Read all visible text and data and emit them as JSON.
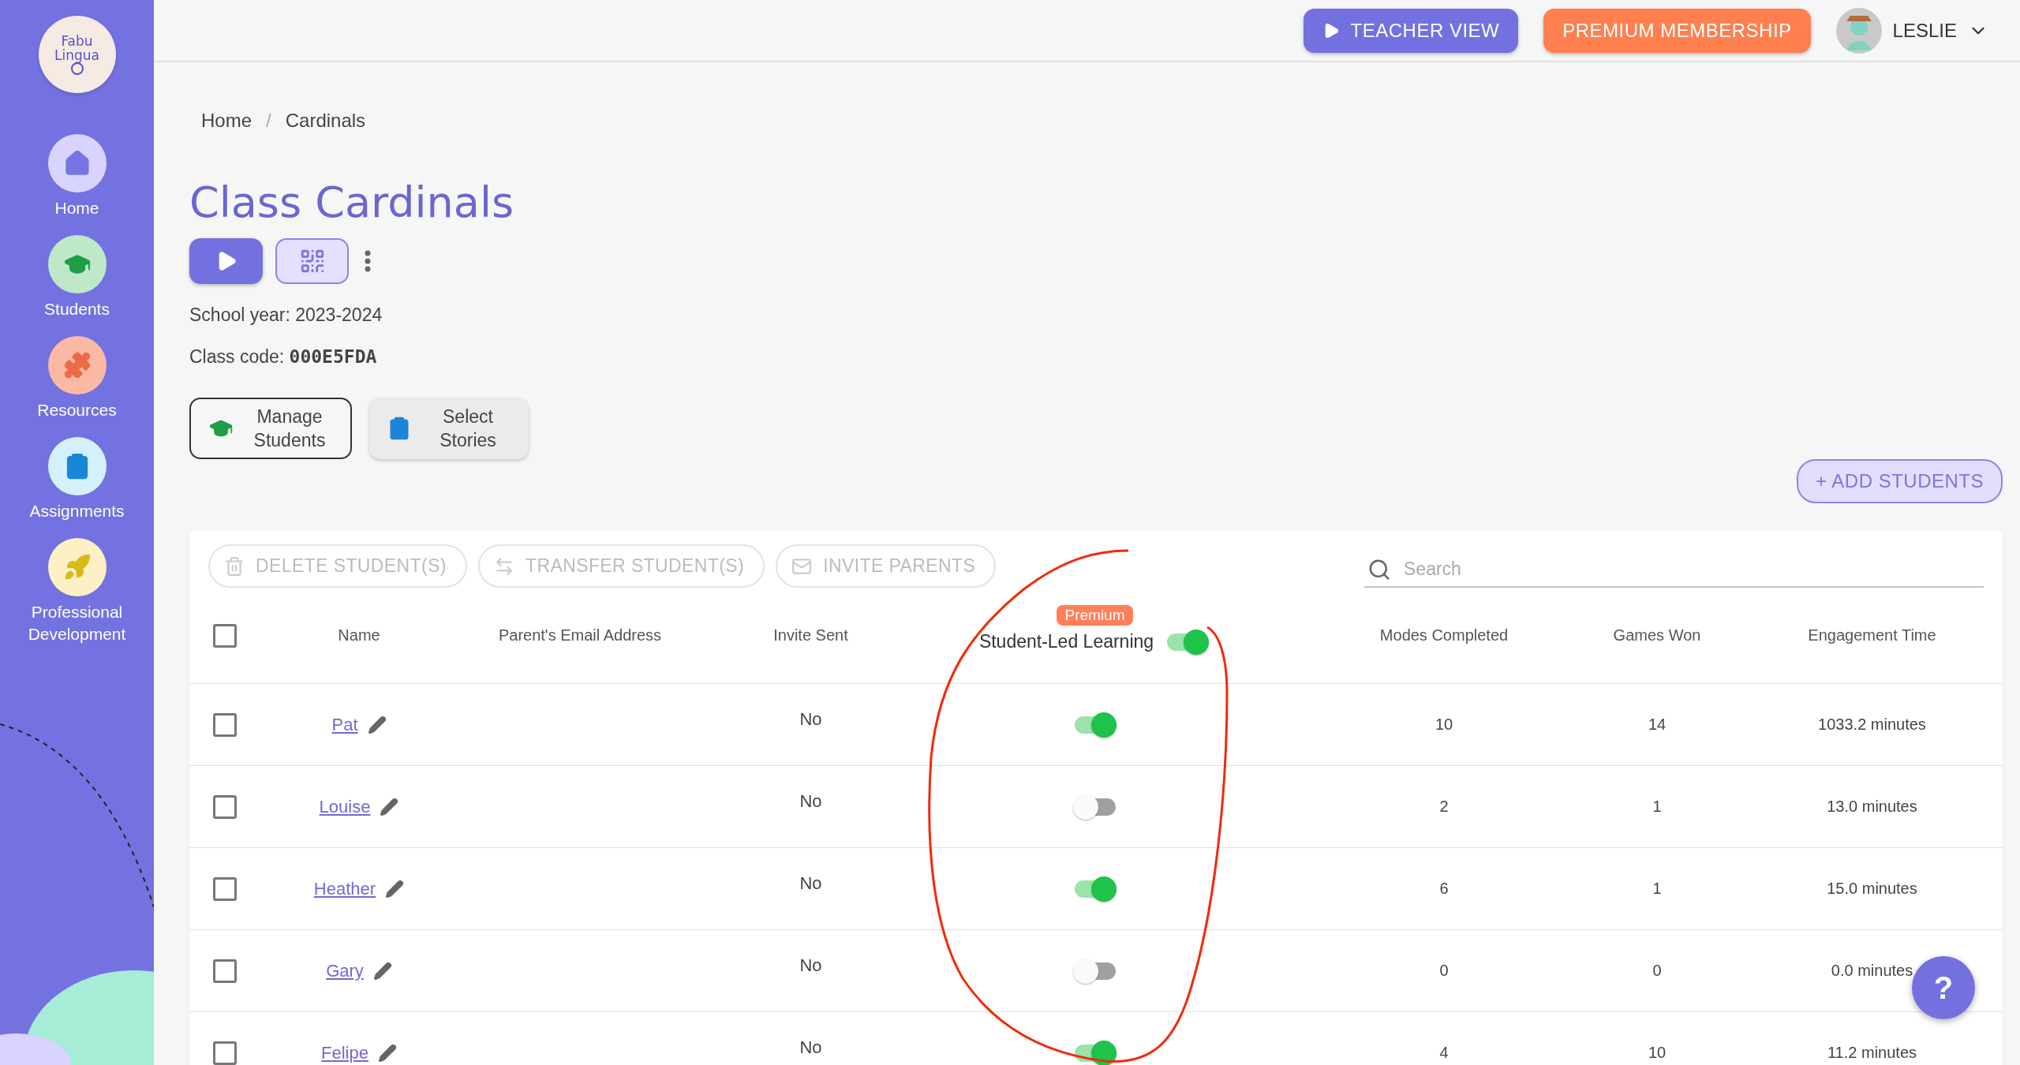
{
  "logo": {
    "line1": "Fabu",
    "line2": "Lingua"
  },
  "sidebar": {
    "items": [
      {
        "label": "Home",
        "kind": "home"
      },
      {
        "label": "Students",
        "kind": "students"
      },
      {
        "label": "Resources",
        "kind": "resources"
      },
      {
        "label": "Assignments",
        "kind": "assignments"
      },
      {
        "label": "Professional Development",
        "kind": "development"
      }
    ]
  },
  "topbar": {
    "teacher_view": "TEACHER VIEW",
    "premium": "PREMIUM MEMBERSHIP",
    "user": "LESLIE"
  },
  "breadcrumb": [
    "Home",
    "Cardinals"
  ],
  "breadcrumb_separator": "/",
  "title": "Class Cardinals",
  "school_year": "School year: 2023-2024",
  "class_code": {
    "label": "Class code:",
    "value": "000E5FDA"
  },
  "actions": [
    {
      "label": "Manage Students",
      "kind": "students"
    },
    {
      "label": "Select Stories",
      "kind": "stories"
    }
  ],
  "add_students": "+ ADD STUDENTS",
  "table": {
    "toolbar": [
      {
        "label": "DELETE STUDENT(S)",
        "kind": "delete",
        "disabled": true
      },
      {
        "label": "TRANSFER STUDENT(S)",
        "kind": "transfer",
        "disabled": true
      },
      {
        "label": "INVITE PARENTS",
        "kind": "invite",
        "disabled": true
      }
    ],
    "search": {
      "placeholder": "Search"
    },
    "select_all_checked": false,
    "premium_badge": "Premium",
    "student_led_all": true,
    "columns": [
      "Name",
      "Parent's Email Address",
      "Invite Sent",
      "Student-Led Learning",
      "Modes Completed",
      "Games Won",
      "Engagement Time"
    ],
    "rows": [
      {
        "name": "Pat",
        "checked": false,
        "invite_sent": "No",
        "student_led": true,
        "modes": "10",
        "games": "14",
        "time": "1033.2 minutes"
      },
      {
        "name": "Louise",
        "checked": false,
        "invite_sent": "No",
        "student_led": false,
        "modes": "2",
        "games": "1",
        "time": "13.0 minutes"
      },
      {
        "name": "Heather",
        "checked": false,
        "invite_sent": "No",
        "student_led": true,
        "modes": "6",
        "games": "1",
        "time": "15.0 minutes"
      },
      {
        "name": "Gary",
        "checked": false,
        "invite_sent": "No",
        "student_led": false,
        "modes": "0",
        "games": "0",
        "time": "0.0 minutes"
      },
      {
        "name": "Felipe",
        "checked": false,
        "invite_sent": "No",
        "student_led": true,
        "modes": "4",
        "games": "10",
        "time": "11.2 minutes"
      }
    ]
  },
  "help": "?"
}
